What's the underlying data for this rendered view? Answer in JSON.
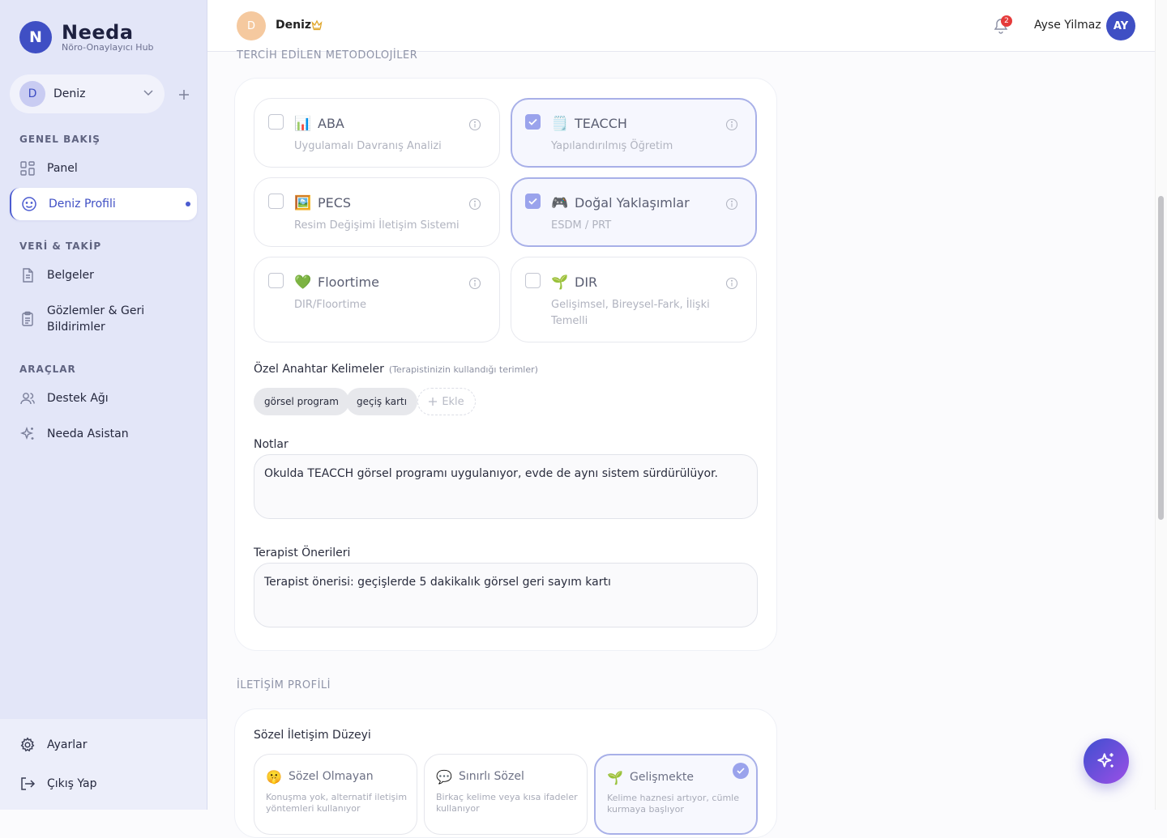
{
  "app": {
    "logo_letter": "N",
    "name": "Needa",
    "tagline": "Nöro-Onaylayıcı Hub"
  },
  "child_switcher": {
    "initial": "D",
    "name": "Deniz"
  },
  "sidebar": {
    "sections": [
      {
        "title": "GENEL BAKIŞ"
      },
      {
        "title": "VERİ & TAKİP"
      },
      {
        "title": "ARAÇLAR"
      }
    ],
    "items": [
      {
        "label": "Panel",
        "icon": "grid-icon"
      },
      {
        "label": "Deniz Profili",
        "icon": "smile-icon",
        "active": true
      },
      {
        "label": "Belgeler",
        "icon": "document-icon"
      },
      {
        "label": "Gözlemler & Geri Bildirimler",
        "icon": "clipboard-icon"
      },
      {
        "label": "Destek Ağı",
        "icon": "users-icon"
      },
      {
        "label": "Needa Asistan",
        "icon": "sparkle-icon"
      }
    ],
    "bottom": [
      {
        "label": "Ayarlar",
        "icon": "gear-icon"
      },
      {
        "label": "Çıkış Yap",
        "icon": "logout-icon"
      }
    ]
  },
  "topbar": {
    "child_initial": "D",
    "child_name": "Deniz",
    "notification_count": "2",
    "user_name": "Ayse Yilmaz",
    "user_initials": "AY"
  },
  "methodologies": {
    "section_title": "TERCİH EDİLEN METODOLOJİLER",
    "options": [
      {
        "title": "ABA",
        "subtitle": "Uygulamalı Davranış Analizi",
        "icon": "📊",
        "checked": false
      },
      {
        "title": "TEACCH",
        "subtitle": "Yapılandırılmış Öğretim",
        "icon": "🗒️",
        "checked": true
      },
      {
        "title": "PECS",
        "subtitle": "Resim Değişimi İletişim Sistemi",
        "icon": "🖼️",
        "checked": false
      },
      {
        "title": "Doğal Yaklaşımlar",
        "subtitle": "ESDM / PRT",
        "icon": "🎮",
        "checked": true
      },
      {
        "title": "Floortime",
        "subtitle": "DIR/Floortime",
        "icon": "💚",
        "checked": false
      },
      {
        "title": "DIR",
        "subtitle": "Gelişimsel, Bireysel-Fark, İlişki Temelli",
        "icon": "🌱",
        "checked": false
      }
    ],
    "keywords_label": "Özel Anahtar Kelimeler",
    "keywords_hint": "(Terapistinizin kullandığı terimler)",
    "keywords": [
      "görsel program",
      "geçiş kartı"
    ],
    "add_label": "Ekle",
    "notes_label": "Notlar",
    "notes_value": "Okulda TEACCH görsel programı uygulanıyor, evde de aynı sistem sürdürülüyor.",
    "therapist_label": "Terapist Önerileri",
    "therapist_value": "Terapist önerisi: geçişlerde 5 dakikalık görsel geri sayım kartı"
  },
  "communication": {
    "section_title": "İLETİŞİM PROFİLİ",
    "verbal_label": "Sözel İletişim Düzeyi",
    "options": [
      {
        "title": "Sözel Olmayan",
        "subtitle": "Konuşma yok, alternatif iletişim yöntemleri kullanıyor",
        "icon": "🤫",
        "selected": false
      },
      {
        "title": "Sınırlı Sözel",
        "subtitle": "Birkaç kelime veya kısa ifadeler kullanıyor",
        "icon": "💬",
        "selected": false
      },
      {
        "title": "Gelişmekte",
        "subtitle": "Kelime haznesi artıyor, cümle kurmaya başlıyor",
        "icon": "🌱",
        "selected": true
      }
    ]
  }
}
